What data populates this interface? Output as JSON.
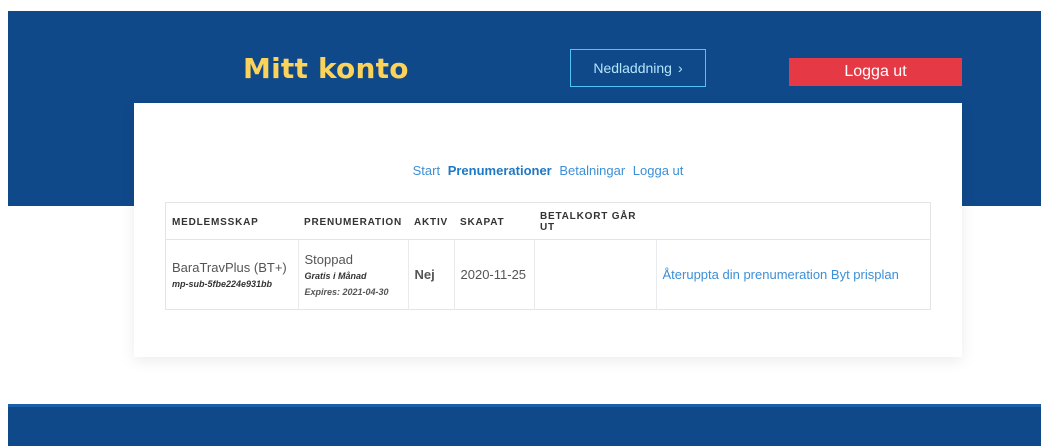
{
  "header": {
    "title": "Mitt konto",
    "download_label": "Nedladdning",
    "download_chevron": "›",
    "logout_label": "Logga ut"
  },
  "subnav": {
    "items": [
      "Start",
      "Prenumerationer",
      "Betalningar",
      "Logga ut"
    ],
    "active": "Prenumerationer"
  },
  "table": {
    "headers": [
      "MEDLEMSSKAP",
      "PRENUMERATION",
      "AKTIV",
      "SKAPAT",
      "BETALKORT GÅR UT",
      ""
    ],
    "rows": [
      {
        "membership": "BaraTravPlus (BT+)",
        "membership_id": "mp-sub-5fbe224e931bb",
        "subscription_status": "Stoppad",
        "subscription_plan": "Gratis i Månad",
        "subscription_expires": "Expires: 2021-04-30",
        "active": "Nej",
        "created": "2020-11-25",
        "card_expires": "",
        "action_resume": "Återuppta din prenumeration",
        "action_change": "Byt prisplan"
      }
    ]
  },
  "colors": {
    "brand_blue": "#10498a",
    "title_yellow": "#fbd35a",
    "logout_red": "#e63946",
    "link_blue": "#3d8fd6",
    "inactive_red": "#8b1a1a"
  }
}
